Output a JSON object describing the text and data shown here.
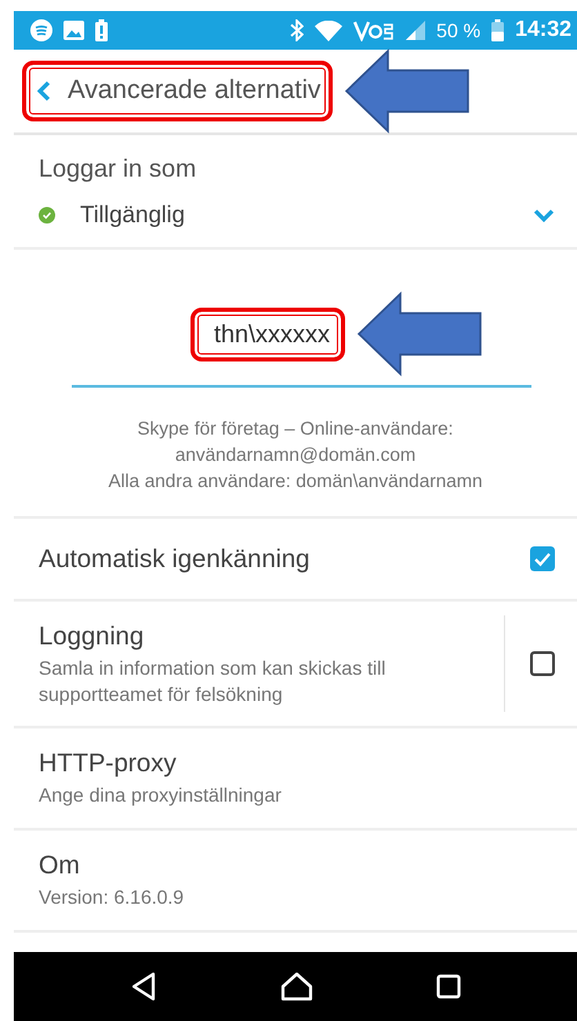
{
  "status_bar": {
    "battery": "50 %",
    "time": "14:32"
  },
  "header": {
    "title": "Avancerade alternativ",
    "annotated": true
  },
  "account": {
    "label": "Loggar in som",
    "status": "Tillgänglig"
  },
  "username": {
    "value": "thn\\xxxxxx",
    "annotated": true
  },
  "help_lines": [
    "Skype för företag – Online-användare:",
    "användarnamn@domän.com",
    "Alla andra användare: domän\\användarnamn"
  ],
  "settings": [
    {
      "kind": "checkbox",
      "title": "Automatisk igenkänning",
      "checked": true
    },
    {
      "kind": "checkbox",
      "title": "Loggning",
      "subtitle": "Samla in information som kan skickas till supportteamet för felsökning",
      "checked": false
    },
    {
      "kind": "link",
      "title": "HTTP-proxy",
      "subtitle": "Ange dina proxyinställningar"
    },
    {
      "kind": "info",
      "title": "Om",
      "subtitle": "Version: 6.16.0.9"
    }
  ]
}
